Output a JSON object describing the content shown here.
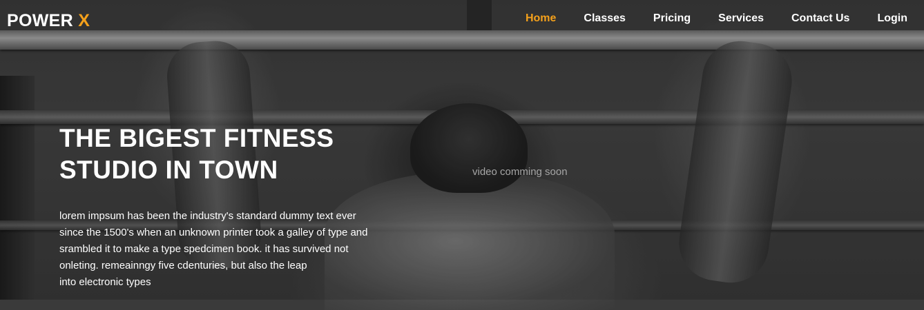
{
  "brand": {
    "name": "POWER",
    "accent": "X",
    "accent_color": "#f5a11b"
  },
  "nav": {
    "items": [
      {
        "label": "Home",
        "active": true
      },
      {
        "label": "Classes",
        "active": false
      },
      {
        "label": "Pricing",
        "active": false
      },
      {
        "label": "Services",
        "active": false
      },
      {
        "label": "Contact Us",
        "active": false
      },
      {
        "label": "Login",
        "active": false
      }
    ]
  },
  "hero": {
    "title_line1": "THE BIGEST FITNESS",
    "title_line2": "STUDIO IN TOWN",
    "text_lines": [
      "lorem impsum has been the industry's standard dummy text ever",
      "since the 1500's when an unknown printer took a galley of type and",
      "srambled it to make a type spedcimen book. it has survived not",
      "onleting. remeainngy five cdenturies, but also the leap",
      "into electronic types"
    ],
    "video_note": "video comming soon",
    "background": "black-and-white photo of a man doing pull-ups on a bar"
  }
}
